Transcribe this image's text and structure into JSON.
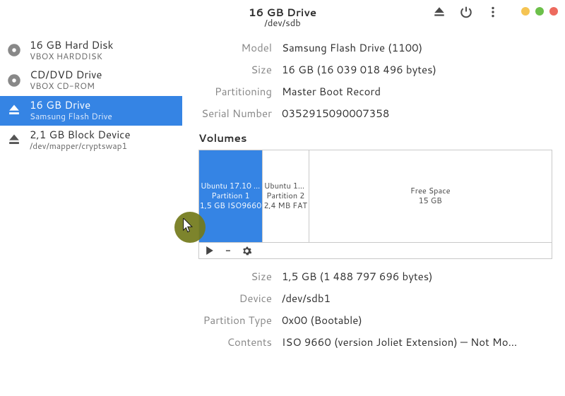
{
  "header": {
    "title": "16 GB Drive",
    "subtitle": "/dev/sdb"
  },
  "sidebar": {
    "items": [
      {
        "icon": "harddisk",
        "title": "16 GB Hard Disk",
        "sub": "VBOX HARDDISK",
        "selected": false
      },
      {
        "icon": "optical",
        "title": "CD/DVD Drive",
        "sub": "VBOX CD-ROM",
        "selected": false
      },
      {
        "icon": "removable",
        "title": "16 GB Drive",
        "sub": "Samsung Flash Drive",
        "selected": true
      },
      {
        "icon": "removable",
        "title": "2,1 GB Block Device",
        "sub": "/dev/mapper/cryptswap1",
        "selected": false
      }
    ]
  },
  "drive": {
    "fields": [
      {
        "label": "Model",
        "value": "Samsung Flash Drive (1100)"
      },
      {
        "label": "Size",
        "value": "16 GB (16 039 018 496 bytes)"
      },
      {
        "label": "Partitioning",
        "value": "Master Boot Record"
      },
      {
        "label": "Serial Number",
        "value": "0352915090007358"
      }
    ]
  },
  "volumes_heading": "Volumes",
  "volumes": [
    {
      "name": "Ubuntu 17.10 a…",
      "line2": "Partition 1",
      "line3": "1,5 GB ISO9660",
      "flex": 14,
      "selected": true
    },
    {
      "name": "Ubuntu 17…",
      "line2": "Partition 2",
      "line3": "2,4 MB FAT",
      "flex": 10,
      "selected": false
    },
    {
      "name": "",
      "line2": "Free Space",
      "line3": "15 GB",
      "flex": 56,
      "selected": false
    }
  ],
  "partition": {
    "fields": [
      {
        "label": "Size",
        "value": "1,5 GB (1 488 797 696 bytes)"
      },
      {
        "label": "Device",
        "value": "/dev/sdb1"
      },
      {
        "label": "Partition Type",
        "value": "0x00 (Bootable)"
      },
      {
        "label": "Contents",
        "value": "ISO 9660 (version Joliet Extension) — Not Mo…"
      }
    ]
  }
}
